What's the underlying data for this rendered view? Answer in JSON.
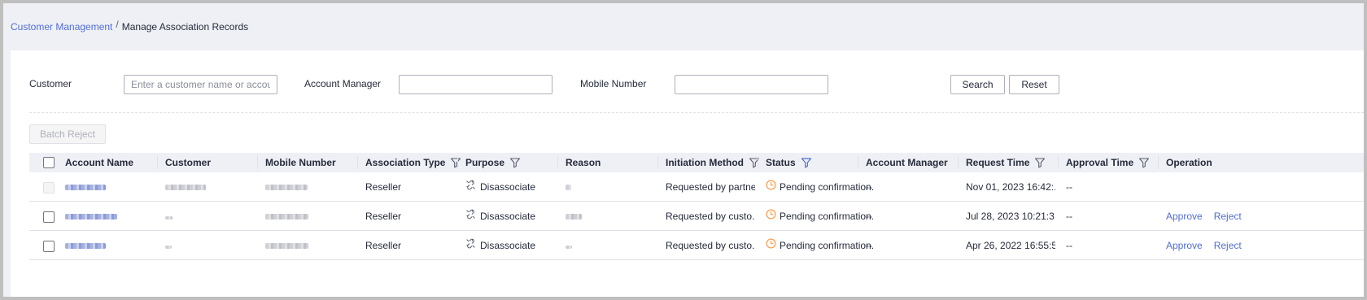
{
  "breadcrumb": {
    "parent": "Customer Management",
    "separator": "/",
    "current": "Manage Association Records"
  },
  "filters": {
    "customer_label": "Customer",
    "customer_placeholder": "Enter a customer name or account.",
    "manager_label": "Account Manager",
    "manager_value": "",
    "mobile_label": "Mobile Number",
    "mobile_value": "",
    "search_label": "Search",
    "reset_label": "Reset"
  },
  "batch_reject_label": "Batch Reject",
  "table": {
    "columns": {
      "account_name": "Account Name",
      "customer": "Customer",
      "mobile_number": "Mobile Number",
      "association_type": "Association Type",
      "purpose": "Purpose",
      "reason": "Reason",
      "initiation_method": "Initiation Method",
      "status": "Status",
      "account_manager": "Account Manager",
      "request_time": "Request Time",
      "approval_time": "Approval Time",
      "operation": "Operation"
    },
    "rows": [
      {
        "association_type": "Reseller",
        "purpose": "Disassociate",
        "initiation_method": "Requested by partners",
        "status": "Pending confirmation.",
        "account_manager": "--",
        "request_time": "Nov 01, 2023 16:42:...",
        "approval_time": "--",
        "checkbox_enabled": false,
        "approve_label": "",
        "reject_label": ""
      },
      {
        "association_type": "Reseller",
        "purpose": "Disassociate",
        "initiation_method": "Requested by custo...",
        "status": "Pending confirmation.",
        "account_manager": "--",
        "request_time": "Jul 28, 2023 10:21:3...",
        "approval_time": "--",
        "checkbox_enabled": true,
        "approve_label": "Approve",
        "reject_label": "Reject"
      },
      {
        "association_type": "Reseller",
        "purpose": "Disassociate",
        "initiation_method": "Requested by custo...",
        "status": "Pending confirmation.",
        "account_manager": "--",
        "request_time": "Apr 26, 2022 16:55:5...",
        "approval_time": "--",
        "checkbox_enabled": true,
        "approve_label": "Approve",
        "reject_label": "Reject"
      }
    ]
  },
  "icons": {
    "filter": "filter-icon",
    "active_filter": "filter-icon-active",
    "unlink": "unlink-icon",
    "clock": "clock-icon"
  },
  "colors": {
    "link": "#526ecc",
    "pending": "#fa9841",
    "header_bg": "#eef0f5",
    "page_bg": "#eef0f5"
  }
}
